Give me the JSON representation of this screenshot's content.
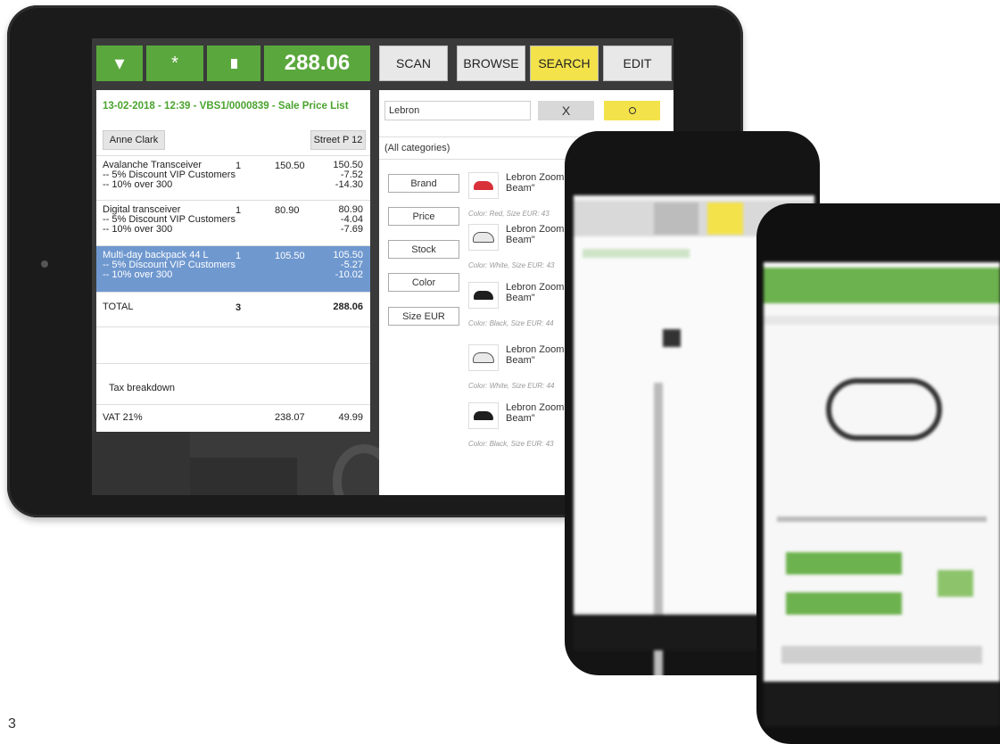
{
  "toolbar": {
    "total": "288.06",
    "icons": [
      "chevron-down-icon",
      "star-icon",
      "trash-icon"
    ],
    "tabs": [
      {
        "label": "SCAN",
        "active": false
      },
      {
        "label": "BROWSE",
        "active": false
      },
      {
        "label": "SEARCH",
        "active": true
      },
      {
        "label": "EDIT",
        "active": false
      }
    ]
  },
  "receipt": {
    "header": "13-02-2018 - 12:39 - VBS1/0000839 - Sale Price List",
    "customer": "Anne Clark",
    "location": "Street P 12",
    "lines": [
      {
        "desc": [
          "Avalanche Transceiver",
          "-- 5% Discount VIP Customers",
          "-- 10% over 300"
        ],
        "qty": "1",
        "price": "150.50",
        "amounts": [
          "150.50",
          "-7.52",
          "-14.30"
        ],
        "selected": false
      },
      {
        "desc": [
          "Digital transceiver",
          "-- 5% Discount VIP Customers",
          "-- 10% over 300"
        ],
        "qty": "1",
        "price": "80.90",
        "amounts": [
          "80.90",
          "-4.04",
          "-7.69"
        ],
        "selected": false
      },
      {
        "desc": [
          "Multi-day backpack 44 L",
          "-- 5% Discount VIP Customers",
          "-- 10% over 300"
        ],
        "qty": "1",
        "price": "105.50",
        "amounts": [
          "105.50",
          "-5.27",
          "-10.02"
        ],
        "selected": true
      }
    ],
    "total_label": "TOTAL",
    "total_qty": "3",
    "total_amount": "288.06",
    "tax_title": "Tax breakdown",
    "tax_label": "VAT 21%",
    "tax_base": "238.07",
    "tax_amount": "49.99"
  },
  "search": {
    "query": "Lebron",
    "clear_label": "X",
    "category": "(All categories)",
    "filters": [
      "Brand",
      "Price",
      "Stock",
      "Color",
      "Size EUR"
    ],
    "results": [
      {
        "name": [
          "Lebron Zoom W",
          "Beam\""
        ],
        "meta": "Color: Red, Size EUR: 43",
        "color": "#d8313a"
      },
      {
        "name": [
          "Lebron Zoom W",
          "Beam\""
        ],
        "meta": "Color: White, Size EUR: 43",
        "color": "#e9e9e9"
      },
      {
        "name": [
          "Lebron Zoom W",
          "Beam\""
        ],
        "meta": "Color: Black, Size EUR: 44",
        "color": "#1e1e1e"
      },
      {
        "name": [
          "Lebron Zoom W",
          "Beam\""
        ],
        "meta": "Color: White, Size EUR: 44",
        "color": "#e9e9e9"
      },
      {
        "name": [
          "Lebron Zoom W",
          "Beam\""
        ],
        "meta": "Color: Black, Size EUR: 43",
        "color": "#1e1e1e"
      }
    ]
  },
  "caption": "3",
  "colors": {
    "green": "#5aa73d",
    "yellow": "#f3e24a",
    "selected_row": "#6f98cf"
  }
}
